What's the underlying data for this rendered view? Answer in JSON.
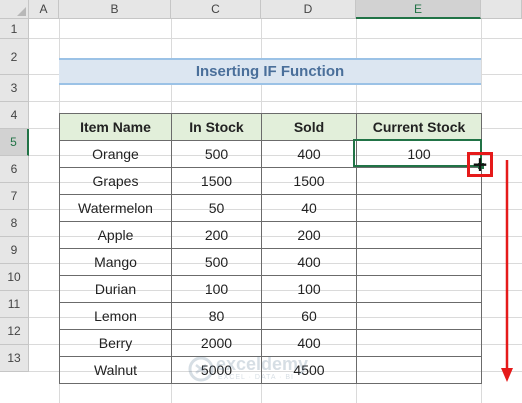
{
  "columns": [
    "A",
    "B",
    "C",
    "D",
    "E"
  ],
  "rows": [
    "1",
    "2",
    "3",
    "4",
    "5",
    "6",
    "7",
    "8",
    "9",
    "10",
    "11",
    "12",
    "13"
  ],
  "selected_column": "E",
  "selected_row": "5",
  "title": "Inserting IF Function",
  "table": {
    "headers": [
      "Item Name",
      "In Stock",
      "Sold",
      "Current Stock"
    ],
    "rows": [
      [
        "Orange",
        "500",
        "400",
        "100"
      ],
      [
        "Grapes",
        "1500",
        "1500",
        ""
      ],
      [
        "Watermelon",
        "50",
        "40",
        ""
      ],
      [
        "Apple",
        "200",
        "200",
        ""
      ],
      [
        "Mango",
        "500",
        "400",
        ""
      ],
      [
        "Durian",
        "100",
        "100",
        ""
      ],
      [
        "Lemon",
        "80",
        "60",
        ""
      ],
      [
        "Berry",
        "2000",
        "400",
        ""
      ],
      [
        "Walnut",
        "5000",
        "4500",
        ""
      ]
    ]
  },
  "watermark": {
    "name": "exceldemy",
    "tagline": "EXCEL · DATA · BI"
  },
  "colors": {
    "accent": "#217346",
    "highlight": "#e51a1a",
    "title_bg": "#dce6f1",
    "header_bg": "#e2efda"
  }
}
